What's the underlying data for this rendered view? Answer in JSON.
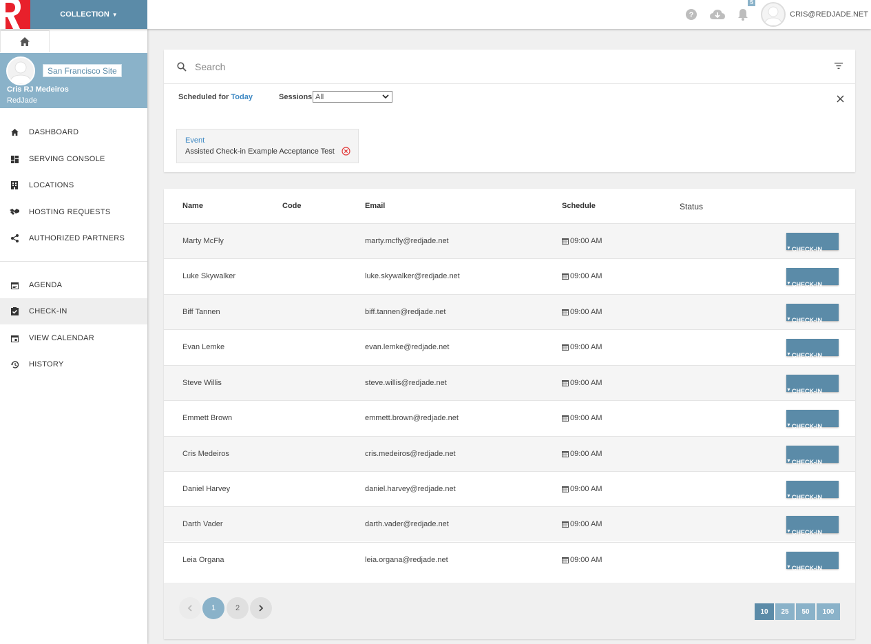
{
  "header": {
    "collection_label": "COLLECTION",
    "notification_count": "5",
    "user_email": "CRIS@REDJADE.NET",
    "icons": [
      "help-icon",
      "cloud-download-icon",
      "bell-icon"
    ]
  },
  "sidebar": {
    "site_button": "San Francisco Site",
    "user_name": "Cris RJ Medeiros",
    "org": "RedJade",
    "primary_items": [
      {
        "label": "DASHBOARD",
        "icon": "home-icon"
      },
      {
        "label": "SERVING CONSOLE",
        "icon": "dashboard-icon"
      },
      {
        "label": "LOCATIONS",
        "icon": "building-icon"
      },
      {
        "label": "HOSTING REQUESTS",
        "icon": "handshake-icon"
      },
      {
        "label": "AUTHORIZED PARTNERS",
        "icon": "share-icon"
      }
    ],
    "secondary_items": [
      {
        "label": "AGENDA",
        "icon": "agenda-icon"
      },
      {
        "label": "CHECK-IN",
        "icon": "check-clipboard-icon",
        "active": true
      },
      {
        "label": "VIEW CALENDAR",
        "icon": "calendar-icon"
      },
      {
        "label": "HISTORY",
        "icon": "history-icon"
      }
    ]
  },
  "search": {
    "placeholder": "Search"
  },
  "filters": {
    "scheduled_label": "Scheduled for",
    "scheduled_value": "Today",
    "sessions_label": "Sessions",
    "sessions_value": "All"
  },
  "event_chip": {
    "type": "Event",
    "name": "Assisted Check-in Example Acceptance Test"
  },
  "table": {
    "headers": {
      "name": "Name",
      "code": "Code",
      "email": "Email",
      "schedule": "Schedule",
      "status": "Status"
    },
    "action_label": "CHECK-IN",
    "rows": [
      {
        "name": "Marty McFly",
        "email": "marty.mcfly@redjade.net",
        "schedule": "09:00 AM"
      },
      {
        "name": "Luke Skywalker",
        "email": "luke.skywalker@redjade.net",
        "schedule": "09:00 AM"
      },
      {
        "name": "Biff Tannen",
        "email": "biff.tannen@redjade.net",
        "schedule": "09:00 AM"
      },
      {
        "name": "Evan Lemke",
        "email": "evan.lemke@redjade.net",
        "schedule": "09:00 AM"
      },
      {
        "name": "Steve Willis",
        "email": "steve.willis@redjade.net",
        "schedule": "09:00 AM"
      },
      {
        "name": "Emmett Brown",
        "email": "emmett.brown@redjade.net",
        "schedule": "09:00 AM"
      },
      {
        "name": "Cris Medeiros",
        "email": "cris.medeiros@redjade.net",
        "schedule": "09:00 AM"
      },
      {
        "name": "Daniel Harvey",
        "email": "daniel.harvey@redjade.net",
        "schedule": "09:00 AM"
      },
      {
        "name": "Darth Vader",
        "email": "darth.vader@redjade.net",
        "schedule": "09:00 AM"
      },
      {
        "name": "Leia Organa",
        "email": "leia.organa@redjade.net",
        "schedule": "09:00 AM"
      }
    ]
  },
  "pagination": {
    "pages": [
      "1",
      "2"
    ],
    "current": "1",
    "page_sizes": [
      "10",
      "25",
      "50",
      "100"
    ],
    "current_size": "10"
  },
  "colors": {
    "brand_red": "#e8202b",
    "primary": "#5b8ba8",
    "accent": "#8ab2c9",
    "link": "#3d88c3"
  }
}
